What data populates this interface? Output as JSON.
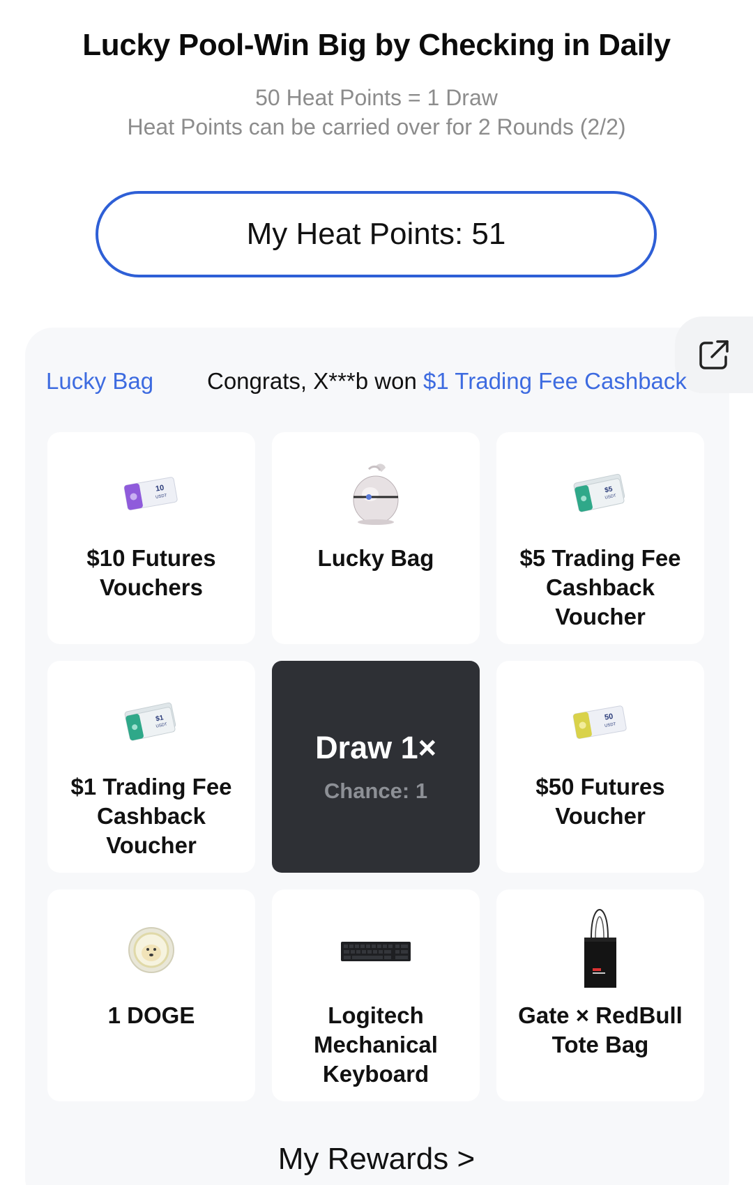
{
  "header": {
    "title": "Lucky Pool-Win Big by Checking in Daily",
    "subtitle_1": "50 Heat Points = 1 Draw",
    "subtitle_2": "Heat Points can be carried over for 2 Rounds (2/2)"
  },
  "heat_points": {
    "label": "My Heat Points: 51"
  },
  "marquee": {
    "tag": "Lucky Bag",
    "message_prefix": "Congrats, X***b won ",
    "message_prize": "$1 Trading Fee Cashback"
  },
  "share": {
    "icon": "share-external-icon"
  },
  "prizes": [
    {
      "label": "$10 Futures Vouchers",
      "icon": "voucher-10-usdt-icon"
    },
    {
      "label": "Lucky Bag",
      "icon": "lucky-bag-icon"
    },
    {
      "label": "$5 Trading Fee Cashback Voucher",
      "icon": "voucher-5-usdt-icon"
    },
    {
      "label": "$1 Trading Fee Cashback Voucher",
      "icon": "voucher-1-usdt-icon"
    },
    {
      "label": "$50 Futures Voucher",
      "icon": "voucher-50-usdt-icon"
    },
    {
      "label": "1 DOGE",
      "icon": "doge-coin-icon"
    },
    {
      "label": "Logitech Mechanical Keyboard",
      "icon": "keyboard-icon"
    },
    {
      "label": "Gate × RedBull Tote Bag",
      "icon": "tote-bag-icon"
    }
  ],
  "voucher_texts": {
    "v10_amount": "10",
    "v10_unit": "USDT",
    "v5_amount": "$5",
    "v5_unit": "USDT",
    "v1_amount": "$1",
    "v1_unit": "USDT",
    "v50_amount": "50",
    "v50_unit": "USDT"
  },
  "draw": {
    "title": "Draw 1×",
    "chance": "Chance: 1"
  },
  "footer": {
    "rewards_link": "My Rewards >"
  },
  "colors": {
    "accent_blue": "#2e5fd6",
    "draw_bg": "#2e3035",
    "panel_bg": "#f7f8fa"
  }
}
